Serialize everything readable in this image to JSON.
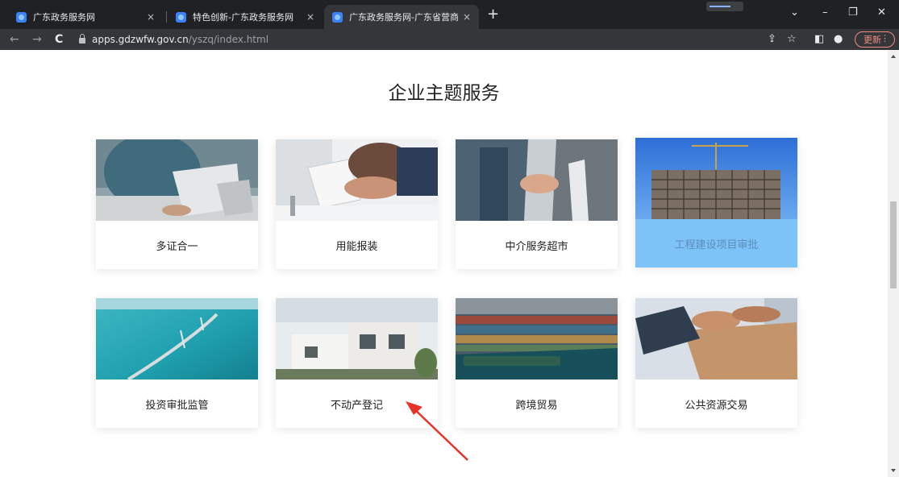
{
  "browser": {
    "tabs": [
      {
        "title": "广东政务服务网",
        "close": "×"
      },
      {
        "title": "特色创新-广东政务服务网",
        "close": "×"
      },
      {
        "title": "广东政务服务网-广东省营商环境",
        "close": "×"
      }
    ],
    "new_tab": "+",
    "window_controls": {
      "dropdown": "⌄",
      "minimize": "–",
      "restore": "❐",
      "close": "✕"
    },
    "nav": {
      "back": "←",
      "forward": "→",
      "reload": "C"
    },
    "url_host": "apps.gdzwfw.gov.cn",
    "url_path": "/yszq/index.html",
    "update_label": "更新",
    "update_menu": "⋮",
    "toolbar_icons": {
      "share": "⇪",
      "bookmark": "☆",
      "sidepanel": "◧",
      "profile": "●"
    }
  },
  "section": {
    "title": "企业主题服务"
  },
  "cards": [
    {
      "label": "多证合一",
      "icon": "office-laptop-image"
    },
    {
      "label": "用能报装",
      "icon": "team-laptop-image"
    },
    {
      "label": "中介服务超市",
      "icon": "handshake-image"
    },
    {
      "label": "工程建设项目审批",
      "icon": "construction-image",
      "highlighted": true
    },
    {
      "label": "投资审批监管",
      "icon": "sea-bridge-image"
    },
    {
      "label": "不动产登记",
      "icon": "villa-building-image"
    },
    {
      "label": "跨境贸易",
      "icon": "cargo-port-image"
    },
    {
      "label": "公共资源交易",
      "icon": "document-handshake-image"
    }
  ],
  "colors": {
    "highlight_card": "#7dc3f7",
    "arrow": "#e8332a"
  }
}
